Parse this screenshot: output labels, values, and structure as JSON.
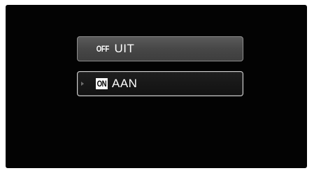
{
  "menu": {
    "options": [
      {
        "badge": "OFF",
        "label": "UIT",
        "selected": false
      },
      {
        "badge": "ON",
        "label": "AAN",
        "selected": true
      }
    ]
  },
  "colors": {
    "screen_background": "#030303",
    "option_background": "#4a4a4a",
    "selected_background": "#161616",
    "text": "#ffffff"
  }
}
